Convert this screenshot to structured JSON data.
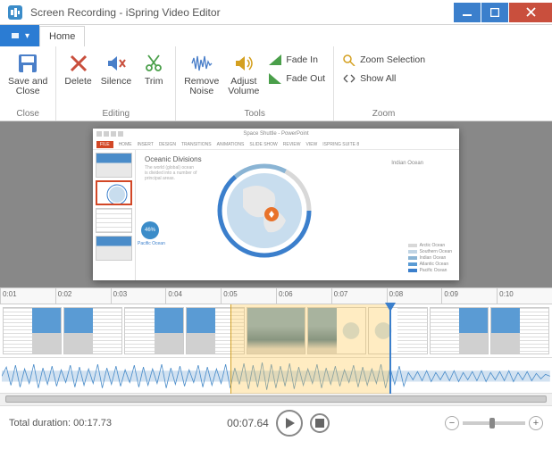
{
  "window": {
    "title": "Screen Recording - iSpring Video Editor"
  },
  "tabs": {
    "file_glyph": "▾",
    "home": "Home"
  },
  "ribbon": {
    "close": {
      "save_close": "Save and\nClose",
      "label": "Close"
    },
    "editing": {
      "delete": "Delete",
      "silence": "Silence",
      "trim": "Trim",
      "label": "Editing"
    },
    "tools": {
      "remove_noise": "Remove\nNoise",
      "adjust_volume": "Adjust\nVolume",
      "fade_in": "Fade In",
      "fade_out": "Fade Out",
      "label": "Tools"
    },
    "zoom": {
      "zoom_selection": "Zoom Selection",
      "show_all": "Show All",
      "label": "Zoom"
    }
  },
  "ppt": {
    "doc_title": "Space Shuttle - PowerPoint",
    "tabs": [
      "FILE",
      "HOME",
      "INSERT",
      "DESIGN",
      "TRANSITIONS",
      "ANIMATIONS",
      "SLIDE SHOW",
      "REVIEW",
      "VIEW",
      "ISPRING SUITE 8"
    ],
    "slide_title": "Oceanic Divisions",
    "slide_sub": "The world (global) ocean is divided into a number of principal areas.",
    "pacific_pct": "46%",
    "pacific_lbl": "Pacific Ocean",
    "indian_lbl": "Indian Ocean",
    "legend": [
      {
        "c": "#d8d8d8",
        "t": "Arctic Ocean"
      },
      {
        "c": "#c0d4e4",
        "t": "Southern Ocean"
      },
      {
        "c": "#8ab4d4",
        "t": "Indian Ocean"
      },
      {
        "c": "#5a9bd4",
        "t": "Atlantic Ocean"
      },
      {
        "c": "#3b7fcc",
        "t": "Pacific Ocean"
      }
    ]
  },
  "ruler_ticks": [
    "0:01",
    "0:02",
    "0:03",
    "0:04",
    "0:05",
    "0:06",
    "0:07",
    "0:08",
    "0:09",
    "0:10"
  ],
  "footer": {
    "total_label": "Total duration:",
    "total_value": "00:17.73",
    "current_time": "00:07.64"
  }
}
